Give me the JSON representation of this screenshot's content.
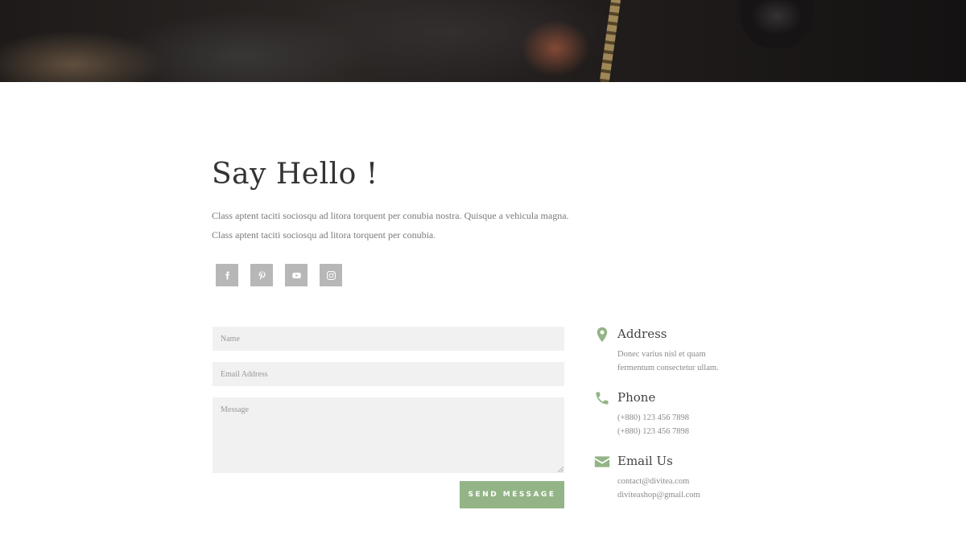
{
  "page": {
    "title": "Say Hello !",
    "intro": "Class aptent taciti sociosqu ad litora torquent per conubia nostra. Quisque a vehicula magna. Class aptent taciti sociosqu ad litora torquent per conubia."
  },
  "socials": [
    {
      "icon": "facebook-icon"
    },
    {
      "icon": "pinterest-icon"
    },
    {
      "icon": "youtube-icon"
    },
    {
      "icon": "instagram-icon"
    }
  ],
  "form": {
    "name_placeholder": "Name",
    "email_placeholder": "Email Address",
    "message_placeholder": "Message",
    "name_value": "",
    "email_value": "",
    "message_value": "",
    "submit_label": "SEND MESSAGE"
  },
  "contact": {
    "address": {
      "icon": "map-pin-icon",
      "heading": "Address",
      "lines": [
        "Donec varius nisl et quam",
        "fermentum consectetur ullam."
      ]
    },
    "phone": {
      "icon": "phone-icon",
      "heading": "Phone",
      "lines": [
        "(+880) 123 456 7898",
        "(+880) 123 456 7898"
      ]
    },
    "email": {
      "icon": "envelope-icon",
      "heading": "Email Us",
      "lines": [
        "contact@divitea.com",
        "diviteashop@gmail.com"
      ]
    }
  },
  "colors": {
    "accent": "#93b486",
    "social_bg": "#b7b7b7",
    "field_bg": "#f1f1f1",
    "title": "#333333",
    "body_text": "#7a7a7a"
  }
}
